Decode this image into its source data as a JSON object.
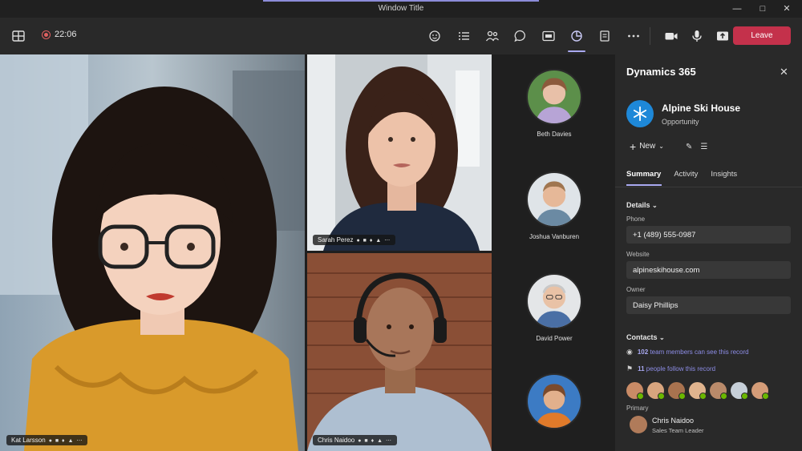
{
  "window": {
    "title": "Window Title"
  },
  "toolbar": {
    "timer": "22:06",
    "leave_label": "Leave"
  },
  "tiles": [
    {
      "name": "Kat Larsson"
    },
    {
      "name": "Sarah Perez"
    },
    {
      "name": "Chris Naidoo"
    }
  ],
  "roster": [
    {
      "name": "Beth Davies"
    },
    {
      "name": "Joshua Vanburen"
    },
    {
      "name": "David Power"
    },
    {
      "name": ""
    }
  ],
  "panel": {
    "title": "Dynamics 365",
    "record": {
      "name": "Alpine Ski House",
      "type": "Opportunity"
    },
    "new_label": "New",
    "tabs": [
      "Summary",
      "Activity",
      "Insights"
    ],
    "details_heading": "Details",
    "fields": [
      {
        "label": "Phone",
        "value": "+1 (489) 555-0987"
      },
      {
        "label": "Website",
        "value": "alpineskihouse.com"
      },
      {
        "label": "Owner",
        "value": "Daisy Phillips"
      }
    ],
    "contacts_heading": "Contacts",
    "team_count": "102",
    "team_text": "team members can see this record",
    "follow_count": "11",
    "follow_text": "people follow this record",
    "primary_label": "Primary",
    "primary_contact": {
      "name": "Chris Naidoo",
      "role": "Sales Team Leader"
    }
  },
  "colors": {
    "leave": "#c4314b",
    "accent": "#a9a9f0",
    "brand": "#1e88d8"
  }
}
